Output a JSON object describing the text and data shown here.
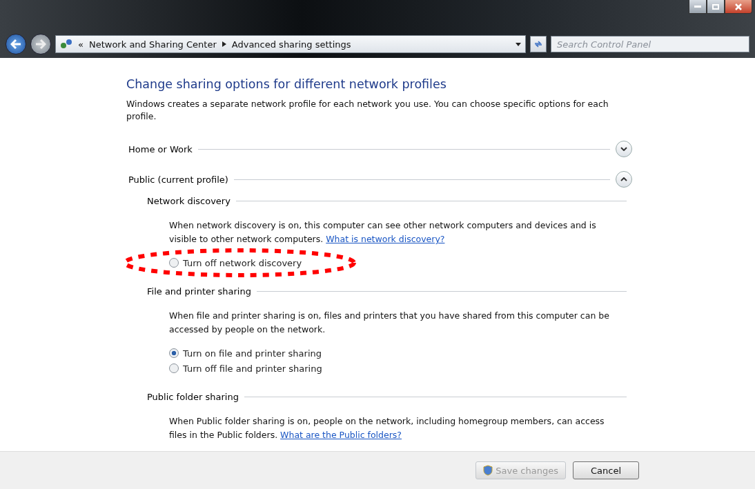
{
  "address_bar": {
    "overflow": "«",
    "crumbs": [
      "Network and Sharing Center",
      "Advanced sharing settings"
    ]
  },
  "search": {
    "placeholder": "Search Control Panel"
  },
  "heading": "Change sharing options for different network profiles",
  "intro": "Windows creates a separate network profile for each network you use. You can choose specific options for each profile.",
  "profiles": [
    {
      "label": "Home or Work",
      "expanded": false
    },
    {
      "label": "Public (current profile)",
      "expanded": true,
      "groups": [
        {
          "title": "Network discovery",
          "description": "When network discovery is on, this computer can see other network computers and devices and is visible to other network computers.",
          "link": "What is network discovery?",
          "options": [
            {
              "label": "Turn off network discovery",
              "selected": false,
              "highlighted": true
            }
          ]
        },
        {
          "title": "File and printer sharing",
          "description": "When file and printer sharing is on, files and printers that you have shared from this computer can be accessed by people on the network.",
          "options": [
            {
              "label": "Turn on file and printer sharing",
              "selected": true,
              "highlighted": false
            },
            {
              "label": "Turn off file and printer sharing",
              "selected": false,
              "highlighted": false
            }
          ]
        },
        {
          "title": "Public folder sharing",
          "description": "When Public folder sharing is on, people on the network, including homegroup members, can access files in the Public folders.",
          "link": "What are the Public folders?"
        }
      ]
    }
  ],
  "footer": [
    {
      "label": "Save changes",
      "disabled": true
    },
    {
      "label": "Cancel",
      "disabled": false
    }
  ]
}
